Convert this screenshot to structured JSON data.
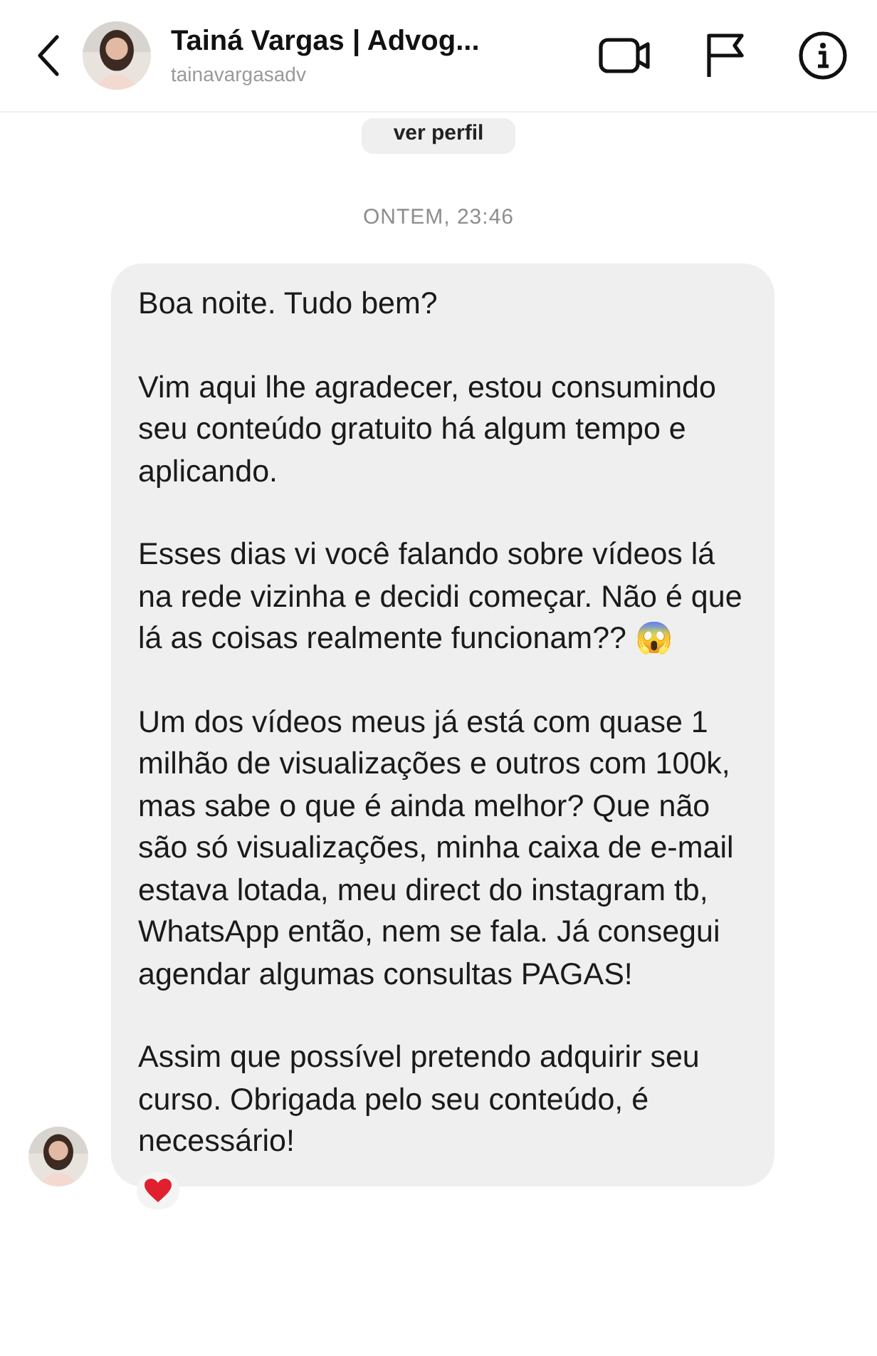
{
  "header": {
    "name": "Tainá Vargas | Advog...",
    "username": "tainavargasadv"
  },
  "profile_button": {
    "label": "ver perfil"
  },
  "timestamp": "ONTEM, 23:46",
  "message": {
    "paragraphs": [
      "Boa noite. Tudo bem?",
      "Vim aqui lhe agradecer, estou consumindo seu conteúdo gratuito há algum tempo e aplicando.",
      "Esses dias vi você falando sobre vídeos lá na rede vizinha e decidi começar. Não é que lá as coisas realmente funcionam?? 😱",
      "Um dos vídeos meus já está com quase 1 milhão de visualizações e outros com 100k, mas sabe o que é ainda melhor? Que não são só visualizações, minha caixa de e-mail estava lotada, meu direct do instagram tb, WhatsApp então, nem se fala. Já consegui agendar algumas consultas PAGAS!",
      "Assim que possível pretendo adquirir seu curso. Obrigada pelo seu conteúdo, é necessário!"
    ]
  }
}
